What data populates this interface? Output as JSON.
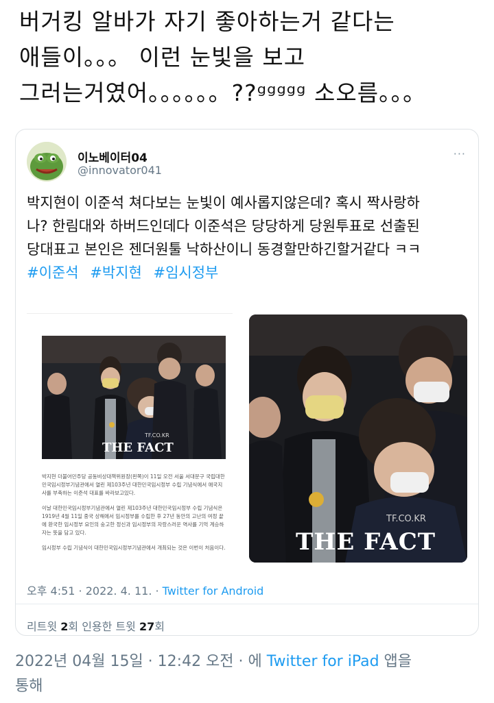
{
  "caption": {
    "line1": "버거킹 알바가 자기 좋아하는거 같다는",
    "line2": "애들이。。。 이런 눈빛을 보고",
    "line3": "그러는거였어。。。。。。??ᵍᵍᵍᵍᵍ 소오름。。。"
  },
  "tweet": {
    "display_name": "이노베이터04",
    "handle": "@innovator041",
    "more_icon": "more-dots-icon",
    "text_line1": "박지현이 이준석 쳐다보는 눈빛이 예사롭지않은데? 혹시 짝사랑하",
    "text_line2": "나?  한림대와 하버드인데다 이준석은 당당하게 당원투표로 선출된",
    "text_line3": "당대표고 본인은 젠더원툴 낙하산이니 동경할만하긴할거같다 ㅋㅋ",
    "hashtags": [
      "#이준석",
      "#박지현",
      "#임시정부"
    ],
    "media": {
      "watermark": "THE FACT",
      "watermark_site": "TF.CO.KR",
      "article_p1": "박지현 더불어민주당 공동비상대책위원장(왼쪽)이 11일 오전 서울 서대문구 국립대한민국임시정부기념관에서 열린 제103주년 대한민국임시정부 수립 기념식에서 애국지사를 부축하는 이준석 대표를 바라보고있다.",
      "article_p2": "이날 대한민국임시정부기념관에서 열린 제103주년 대한민국임시정부 수립 기념식은 1919년 4월 11일 중국 상해에서 임시정부를 수립한 후 27년 동안의 고난의 여정 끝에 환국한 임시정부 요인의 숭고한 정신과 임시정부의 자랑스러운 역사를 기억 계승하자는 뜻을 담고 있다.",
      "article_p3": "임시정부 수립 기념식이 대한민국임시정부기념관에서 개최되는 것은 이번이 처음이다."
    },
    "timestamp_text": "오후 4:51 · 2022. 4. 11. · ",
    "source": "Twitter for Android",
    "retweets_label": "리트윗 ",
    "retweets_count": "2",
    "retweets_unit": "회  ",
    "quotes_label": "인용한 트윗 ",
    "quotes_count": "27",
    "quotes_unit": "회"
  },
  "footer": {
    "date_text": "2022년 04월 15일 · 12:42 오전 · 에 ",
    "source": "Twitter for iPad",
    "suffix": " 앱을",
    "line2": "통해"
  }
}
